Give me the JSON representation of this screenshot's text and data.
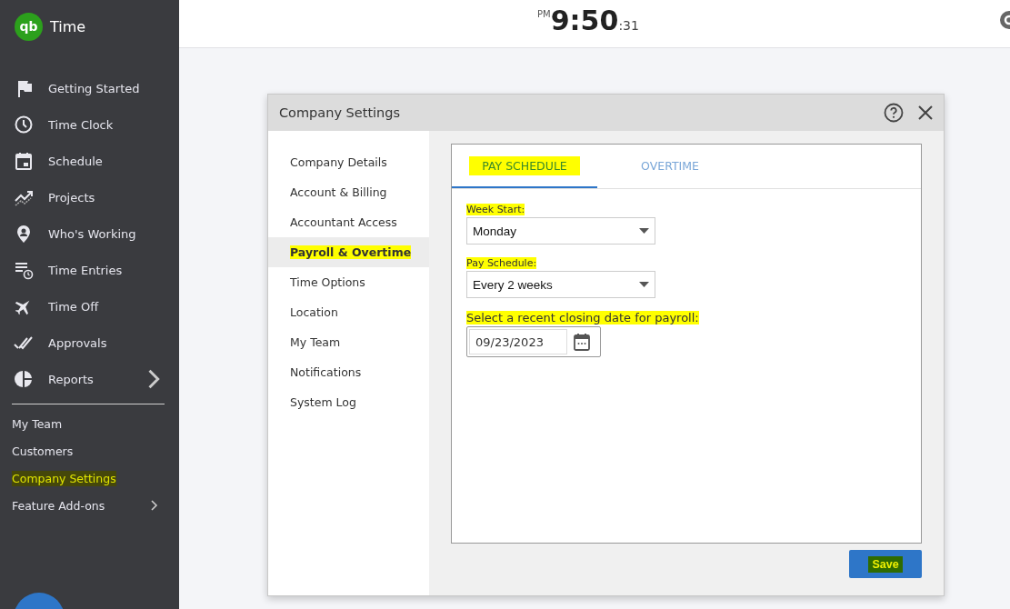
{
  "app": {
    "logo_text": "qb",
    "name": "Time"
  },
  "nav": [
    {
      "label": "Getting Started",
      "has_submenu": false
    },
    {
      "label": "Time Clock",
      "has_submenu": false
    },
    {
      "label": "Schedule",
      "has_submenu": false
    },
    {
      "label": "Projects",
      "has_submenu": false
    },
    {
      "label": "Who's Working",
      "has_submenu": false
    },
    {
      "label": "Time Entries",
      "has_submenu": false
    },
    {
      "label": "Time Off",
      "has_submenu": false
    },
    {
      "label": "Approvals",
      "has_submenu": false
    },
    {
      "label": "Reports",
      "has_submenu": true
    }
  ],
  "secondary_nav": [
    {
      "label": "My Team",
      "has_submenu": false,
      "highlighted": false
    },
    {
      "label": "Customers",
      "has_submenu": false,
      "highlighted": false
    },
    {
      "label": "Company Settings",
      "has_submenu": false,
      "highlighted": true
    },
    {
      "label": "Feature Add-ons",
      "has_submenu": true,
      "highlighted": false
    }
  ],
  "clock": {
    "period": "PM",
    "time": "9:50",
    "seconds": ":31"
  },
  "dialog": {
    "title": "Company Settings",
    "menu": [
      {
        "label": "Company Details",
        "selected": false,
        "highlighted": false
      },
      {
        "label": "Account & Billing",
        "selected": false,
        "highlighted": false
      },
      {
        "label": "Accountant Access",
        "selected": false,
        "highlighted": false
      },
      {
        "label": "Payroll & Overtime",
        "selected": true,
        "highlighted": true
      },
      {
        "label": "Time Options",
        "selected": false,
        "highlighted": false
      },
      {
        "label": "Location",
        "selected": false,
        "highlighted": false
      },
      {
        "label": "My Team",
        "selected": false,
        "highlighted": false
      },
      {
        "label": "Notifications",
        "selected": false,
        "highlighted": false
      },
      {
        "label": "System Log",
        "selected": false,
        "highlighted": false
      }
    ],
    "tabs": [
      {
        "label": "PAY SCHEDULE",
        "selected": true,
        "highlighted": true
      },
      {
        "label": "OVERTIME",
        "selected": false,
        "highlighted": false
      }
    ],
    "fields": [
      {
        "kind": "select",
        "label": "Week Start:",
        "value": "Monday",
        "highlighted": true
      },
      {
        "kind": "select",
        "label": "Pay Schedule:",
        "value": "Every 2 weeks",
        "highlighted": true
      },
      {
        "kind": "date",
        "label": "Select a recent closing date for payroll:",
        "value": "09/23/2023",
        "highlighted": true
      }
    ],
    "save_button": {
      "label": "Save",
      "highlighted": true
    }
  }
}
